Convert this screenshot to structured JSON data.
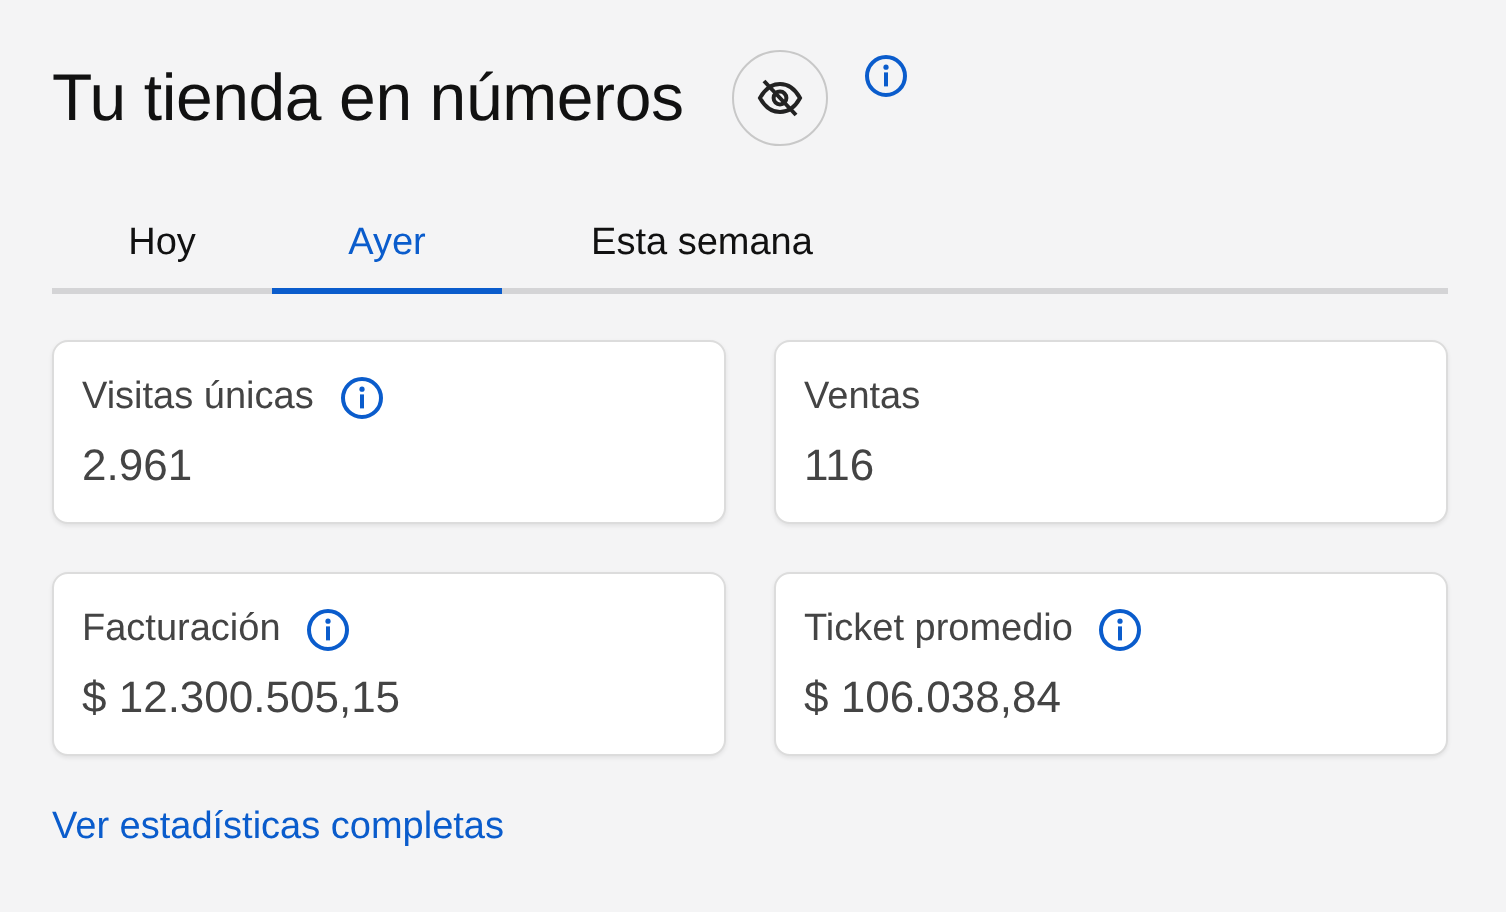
{
  "header": {
    "title": "Tu tienda en números"
  },
  "tabs": [
    {
      "label": "Hoy",
      "selected": false
    },
    {
      "label": "Ayer",
      "selected": true
    },
    {
      "label": "Esta semana",
      "selected": false
    }
  ],
  "metrics": [
    {
      "label": "Visitas únicas",
      "info": true,
      "value": "2.961"
    },
    {
      "label": "Ventas",
      "info": false,
      "value": "116"
    },
    {
      "label": "Facturación",
      "info": true,
      "value": "$ 12.300.505,15"
    },
    {
      "label": "Ticket promedio",
      "info": true,
      "value": "$ 106.038,84"
    }
  ],
  "link": "Ver estadísticas completas"
}
